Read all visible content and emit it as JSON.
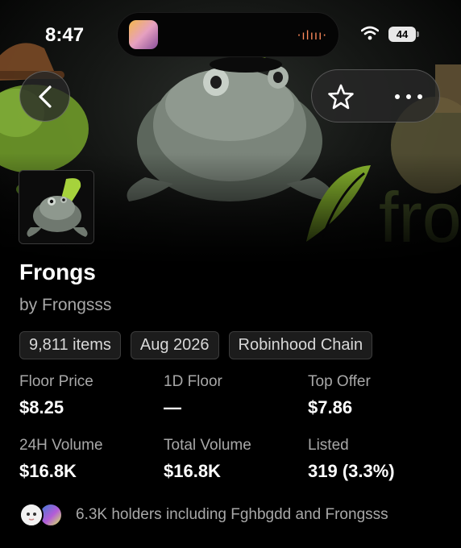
{
  "status_bar": {
    "time": "8:47",
    "battery": "44",
    "island_wave": "·ılııı·"
  },
  "nav": {
    "back_icon": "chevron-left-icon",
    "favorite_icon": "star-icon",
    "more_icon": "ellipsis-icon"
  },
  "collection": {
    "name": "Frongs",
    "creator": "by Frongsss",
    "chips": [
      "9,811 items",
      "Aug 2026",
      "Robinhood Chain"
    ]
  },
  "stats": [
    {
      "label": "Floor Price",
      "value": "$8.25"
    },
    {
      "label": "1D Floor",
      "value": "—"
    },
    {
      "label": "Top Offer",
      "value": "$7.86"
    },
    {
      "label": "24H Volume",
      "value": "$16.8K"
    },
    {
      "label": "Total Volume",
      "value": "$16.8K"
    },
    {
      "label": "Listed",
      "value": "319 (3.3%)"
    }
  ],
  "holders": {
    "text": "6.3K holders including Fghbgdd and Frongsss"
  },
  "banner_watermark": "fro",
  "colors": {
    "background": "#000000",
    "secondary_text": "#a8a8a8",
    "chip_bg": "#1c1c1c",
    "accent_green": "#9fd13a"
  }
}
